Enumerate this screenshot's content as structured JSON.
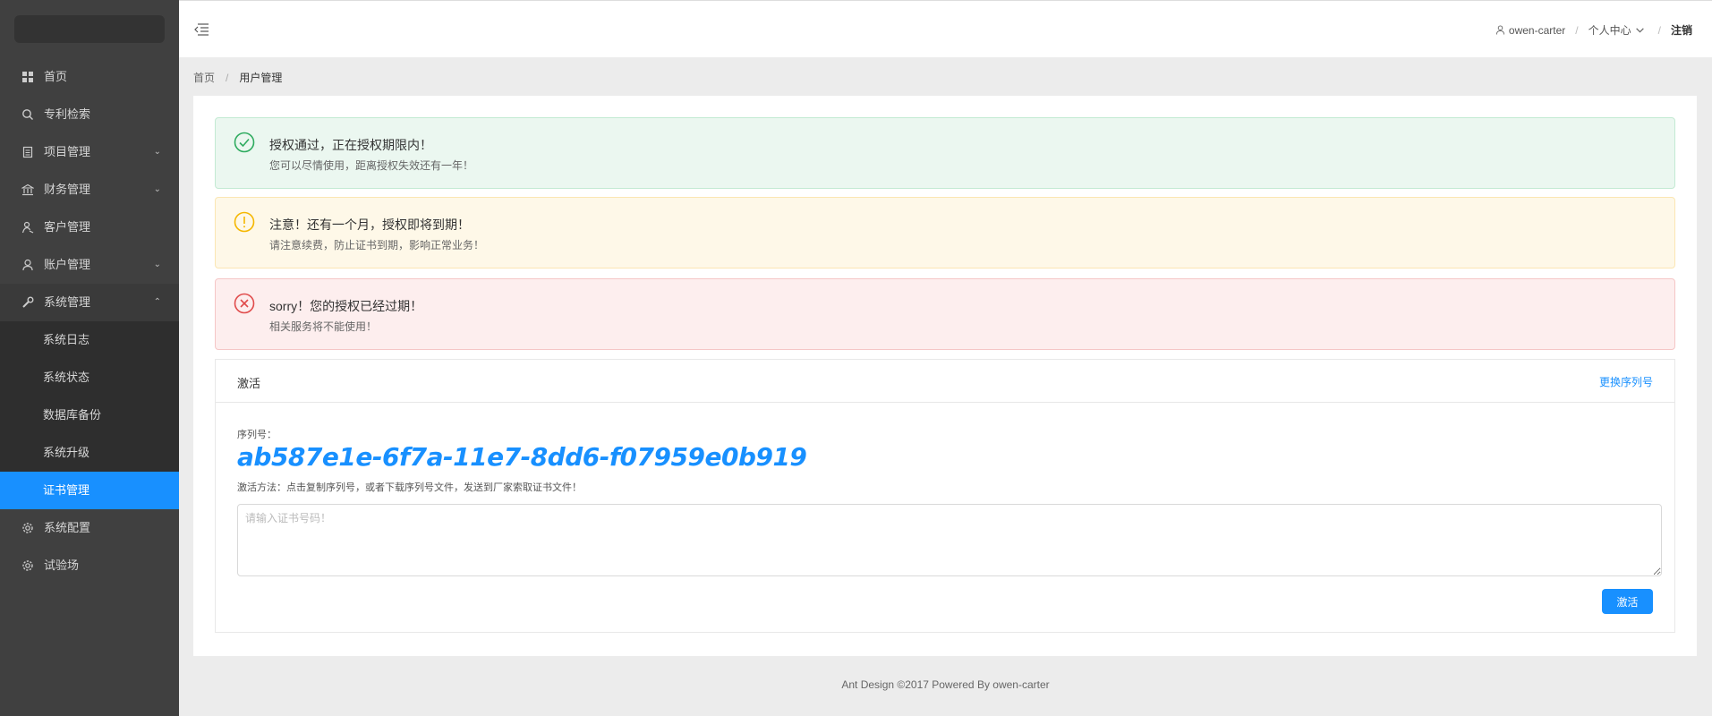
{
  "sidebar": {
    "items": [
      {
        "label": "首页",
        "icon": "dashboard-icon"
      },
      {
        "label": "专利检索",
        "icon": "search-icon"
      },
      {
        "label": "项目管理",
        "icon": "project-icon",
        "arrow": "⌄"
      },
      {
        "label": "财务管理",
        "icon": "bank-icon",
        "arrow": "⌄"
      },
      {
        "label": "客户管理",
        "icon": "customer-icon"
      },
      {
        "label": "账户管理",
        "icon": "user-icon",
        "arrow": "⌄"
      },
      {
        "label": "系统管理",
        "icon": "tool-icon",
        "arrow": "⌃"
      }
    ],
    "submenu": [
      {
        "label": "系统日志"
      },
      {
        "label": "系统状态"
      },
      {
        "label": "数据库备份"
      },
      {
        "label": "系统升级"
      },
      {
        "label": "证书管理"
      }
    ],
    "bottom_items": [
      {
        "label": "系统配置",
        "icon": "setting-icon"
      },
      {
        "label": "试验场",
        "icon": "setting-icon"
      }
    ],
    "active_color": "#1890ff"
  },
  "header": {
    "username": "owen-carter",
    "personal_center": "个人中心",
    "logout": "注销"
  },
  "breadcrumb": {
    "home": "首页",
    "current": "用户管理"
  },
  "alerts": {
    "success": {
      "title": "授权通过，正在授权期限内！",
      "desc": "您可以尽情使用，距离授权失效还有一年！",
      "color": "#2eab5f"
    },
    "warning": {
      "title": "注意！还有一个月，授权即将到期！",
      "desc": "请注意续费，防止证书到期，影响正常业务！",
      "color": "#f5b700"
    },
    "error": {
      "title": "sorry！您的授权已经过期！",
      "desc": "相关服务将不能使用！",
      "color": "#e04b4b"
    }
  },
  "activation": {
    "title": "激活",
    "change_serial": "更换序列号",
    "serial_label": "序列号：",
    "serial": "ab587e1e-6f7a-11e7-8dd6-f07959e0b919",
    "hint": "激活方法：点击复制序列号，或者下载序列号文件，发送到厂家索取证书文件！",
    "input_placeholder": "请输入证书号码！",
    "button": "激活"
  },
  "footer": {
    "text": "Ant Design ©2017 Powered By owen-carter"
  }
}
